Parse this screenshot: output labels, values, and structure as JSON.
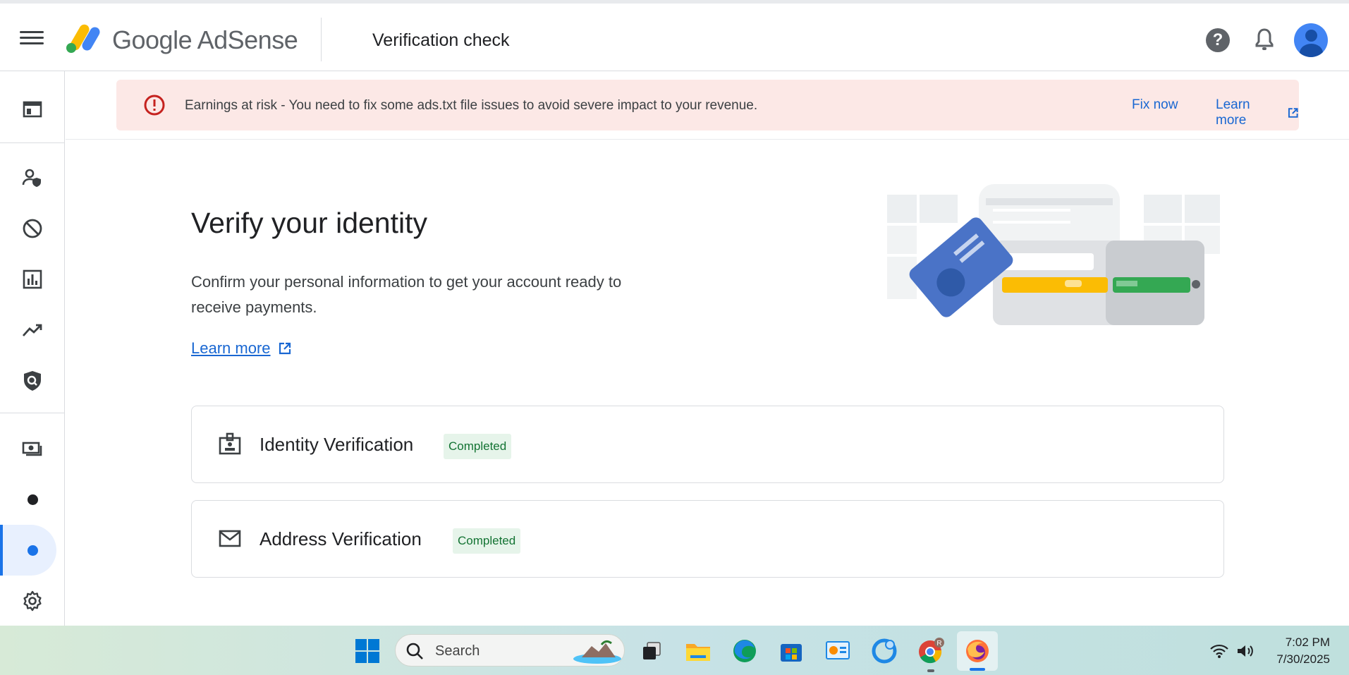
{
  "app": {
    "brand": "Google AdSense",
    "page_title": "Verification check"
  },
  "alert": {
    "message": "Earnings at risk - You need to fix some ads.txt file issues to avoid severe impact to your revenue.",
    "fix_label": "Fix now",
    "learn_label": "Learn more"
  },
  "content": {
    "heading": "Verify your identity",
    "description": "Confirm your personal information to get your account ready to receive payments.",
    "learn_more": "Learn more"
  },
  "verifications": [
    {
      "title": "Identity Verification",
      "status": "Completed"
    },
    {
      "title": "Address Verification",
      "status": "Completed"
    }
  ],
  "taskbar": {
    "search_placeholder": "Search",
    "time": "7:02 PM",
    "date": "7/30/2025",
    "chrome_badge": "R"
  },
  "colors": {
    "accent": "#1a73e8",
    "alert_bg": "#fce8e6",
    "alert_icon": "#c5221f",
    "success_bg": "#e6f4ea",
    "success_text": "#137333"
  }
}
